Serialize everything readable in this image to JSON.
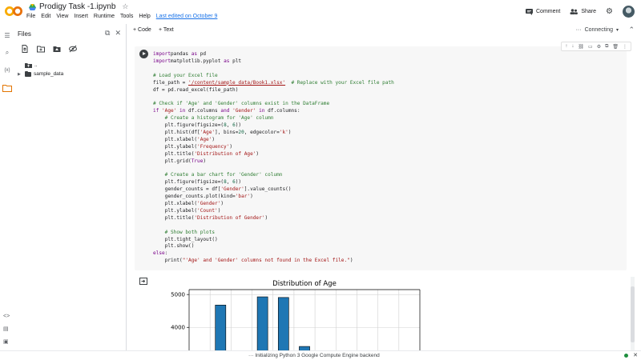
{
  "header": {
    "title": "Prodigy Task -1.ipynb",
    "menu": [
      "File",
      "Edit",
      "View",
      "Insert",
      "Runtime",
      "Tools",
      "Help"
    ],
    "last_edited": "Last edited on October 9",
    "comment_label": "Comment",
    "share_label": "Share"
  },
  "toolbar": {
    "code_label": "+ Code",
    "text_label": "+ Text",
    "connecting_label": "Connecting"
  },
  "files": {
    "title": "Files",
    "tree": [
      {
        "label": ".."
      },
      {
        "label": "sample_data"
      }
    ]
  },
  "code_lines": [
    [
      [
        "kw",
        "import"
      ],
      [
        "",
        "pandas "
      ],
      [
        "kw",
        "as"
      ],
      [
        "",
        " pd"
      ]
    ],
    [
      [
        "kw",
        "import"
      ],
      [
        "",
        "matplotlib.pyplot "
      ],
      [
        "kw",
        "as"
      ],
      [
        "",
        " plt"
      ]
    ],
    [],
    [
      [
        "cm",
        "# Load your Excel file"
      ]
    ],
    [
      [
        "",
        "file_path = "
      ],
      [
        "path",
        "'/content/sample_data/Book1.xlsx'"
      ],
      [
        "cm",
        "  # Replace with your Excel file path"
      ]
    ],
    [
      [
        "",
        "df = pd.read_excel(file_path)"
      ]
    ],
    [],
    [
      [
        "cm",
        "# Check if 'Age' and 'Gender' columns exist in the DataFrame"
      ]
    ],
    [
      [
        "kw",
        "if"
      ],
      [
        "",
        " "
      ],
      [
        "str",
        "'Age'"
      ],
      [
        "",
        " "
      ],
      [
        "kw",
        "in"
      ],
      [
        "",
        " df.columns "
      ],
      [
        "kw",
        "and"
      ],
      [
        "",
        " "
      ],
      [
        "str",
        "'Gender'"
      ],
      [
        "",
        " "
      ],
      [
        "kw",
        "in"
      ],
      [
        "",
        " df.columns:"
      ]
    ],
    [
      [
        "cm",
        "    # Create a histogram for 'Age' column"
      ]
    ],
    [
      [
        "",
        "    plt.figure(figsize=("
      ],
      [
        "num",
        "8"
      ],
      [
        "",
        ", "
      ],
      [
        "num",
        "6"
      ],
      [
        "",
        "))"
      ]
    ],
    [
      [
        "",
        "    plt.hist(df["
      ],
      [
        "str",
        "'Age'"
      ],
      [
        "",
        "], bins="
      ],
      [
        "num",
        "20"
      ],
      [
        "",
        ", edgecolor="
      ],
      [
        "str",
        "'k'"
      ],
      [
        "",
        ")"
      ]
    ],
    [
      [
        "",
        "    plt.xlabel("
      ],
      [
        "str",
        "'Age'"
      ],
      [
        "",
        ")"
      ]
    ],
    [
      [
        "",
        "    plt.ylabel("
      ],
      [
        "str",
        "'Frequency'"
      ],
      [
        "",
        ")"
      ]
    ],
    [
      [
        "",
        "    plt.title("
      ],
      [
        "str",
        "'Distribution of Age'"
      ],
      [
        "",
        ")"
      ]
    ],
    [
      [
        "",
        "    plt.grid("
      ],
      [
        "kw",
        "True"
      ],
      [
        "",
        ")"
      ]
    ],
    [],
    [
      [
        "cm",
        "    # Create a bar chart for 'Gender' column"
      ]
    ],
    [
      [
        "",
        "    plt.figure(figsize=("
      ],
      [
        "num",
        "8"
      ],
      [
        "",
        ", "
      ],
      [
        "num",
        "6"
      ],
      [
        "",
        "))"
      ]
    ],
    [
      [
        "",
        "    gender_counts = df["
      ],
      [
        "str",
        "'Gender'"
      ],
      [
        "",
        "].value_counts()"
      ]
    ],
    [
      [
        "",
        "    gender_counts.plot(kind="
      ],
      [
        "str",
        "'bar'"
      ],
      [
        "",
        ")"
      ]
    ],
    [
      [
        "",
        "    plt.xlabel("
      ],
      [
        "str",
        "'Gender'"
      ],
      [
        "",
        ")"
      ]
    ],
    [
      [
        "",
        "    plt.ylabel("
      ],
      [
        "str",
        "'Count'"
      ],
      [
        "",
        ")"
      ]
    ],
    [
      [
        "",
        "    plt.title("
      ],
      [
        "str",
        "'Distribution of Gender'"
      ],
      [
        "",
        ")"
      ]
    ],
    [],
    [
      [
        "cm",
        "    # Show both plots"
      ]
    ],
    [
      [
        "",
        "    plt.tight_layout()"
      ]
    ],
    [
      [
        "",
        "    plt.show()"
      ]
    ],
    [
      [
        "kw",
        "else"
      ],
      [
        "",
        ":"
      ]
    ],
    [
      [
        "",
        "    print("
      ],
      [
        "str",
        "\"'Age' and 'Gender' columns not found in the Excel file.\""
      ],
      [
        "",
        ")"
      ]
    ]
  ],
  "chart_data": {
    "type": "bar",
    "title": "Distribution of Age",
    "yticks": [
      4000,
      5000
    ],
    "ylim": [
      3300,
      5150
    ],
    "bar_color": "#1f77b4",
    "bars": [
      {
        "slot": 1,
        "value": 4680
      },
      {
        "slot": 3,
        "value": 4930
      },
      {
        "slot": 4,
        "value": 4910
      },
      {
        "slot": 5,
        "value": 3420
      }
    ],
    "slots": 11,
    "grid": true
  },
  "status": {
    "text": "Initializing Python 3 Google Compute Engine backend"
  }
}
